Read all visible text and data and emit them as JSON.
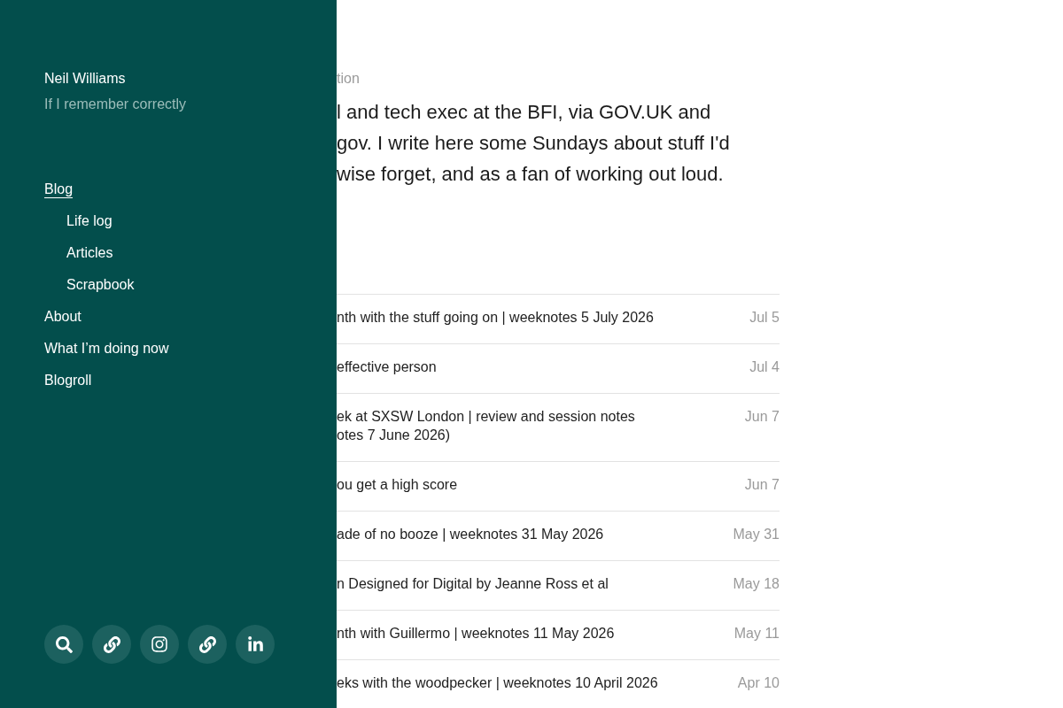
{
  "sidebar": {
    "site_title": "Neil Williams",
    "tagline": "If I remember correctly",
    "nav": [
      {
        "label": "Blog",
        "selected": true,
        "children": [
          {
            "label": "Life log",
            "selected": false
          },
          {
            "label": "Articles",
            "selected": false
          },
          {
            "label": "Scrapbook",
            "selected": false
          }
        ]
      },
      {
        "label": "About",
        "selected": false
      },
      {
        "label": "What I’m doing now",
        "selected": false
      },
      {
        "label": "Blogroll",
        "selected": false
      }
    ]
  },
  "main": {
    "section_label": "tion",
    "intro_lines": [
      "l and tech exec at the BFI, via GOV.UK and",
      "gov. I write here some Sundays about stuff I'd",
      "wise forget, and as a fan of working out loud."
    ],
    "posts": [
      {
        "title_lines": [
          "nth with the stuff going on | weeknotes 5 July 2026"
        ],
        "date": "Jul 5"
      },
      {
        "title_lines": [
          "effective person"
        ],
        "date": "Jul 4"
      },
      {
        "title_lines": [
          "ek at SXSW London | review and session notes",
          "otes 7 June 2026)"
        ],
        "date": "Jun 7"
      },
      {
        "title_lines": [
          "ou get a high score"
        ],
        "date": "Jun 7"
      },
      {
        "title_lines": [
          "ade of no booze | weeknotes 31 May 2026"
        ],
        "date": "May 31"
      },
      {
        "title_lines": [
          "n Designed for Digital by Jeanne Ross et al"
        ],
        "date": "May 18"
      },
      {
        "title_lines": [
          "nth with Guillermo | weeknotes 11 May 2026"
        ],
        "date": "May 11"
      },
      {
        "title_lines": [
          "eks with the woodpecker | weeknotes 10 April 2026"
        ],
        "date": "Apr 10"
      }
    ]
  }
}
